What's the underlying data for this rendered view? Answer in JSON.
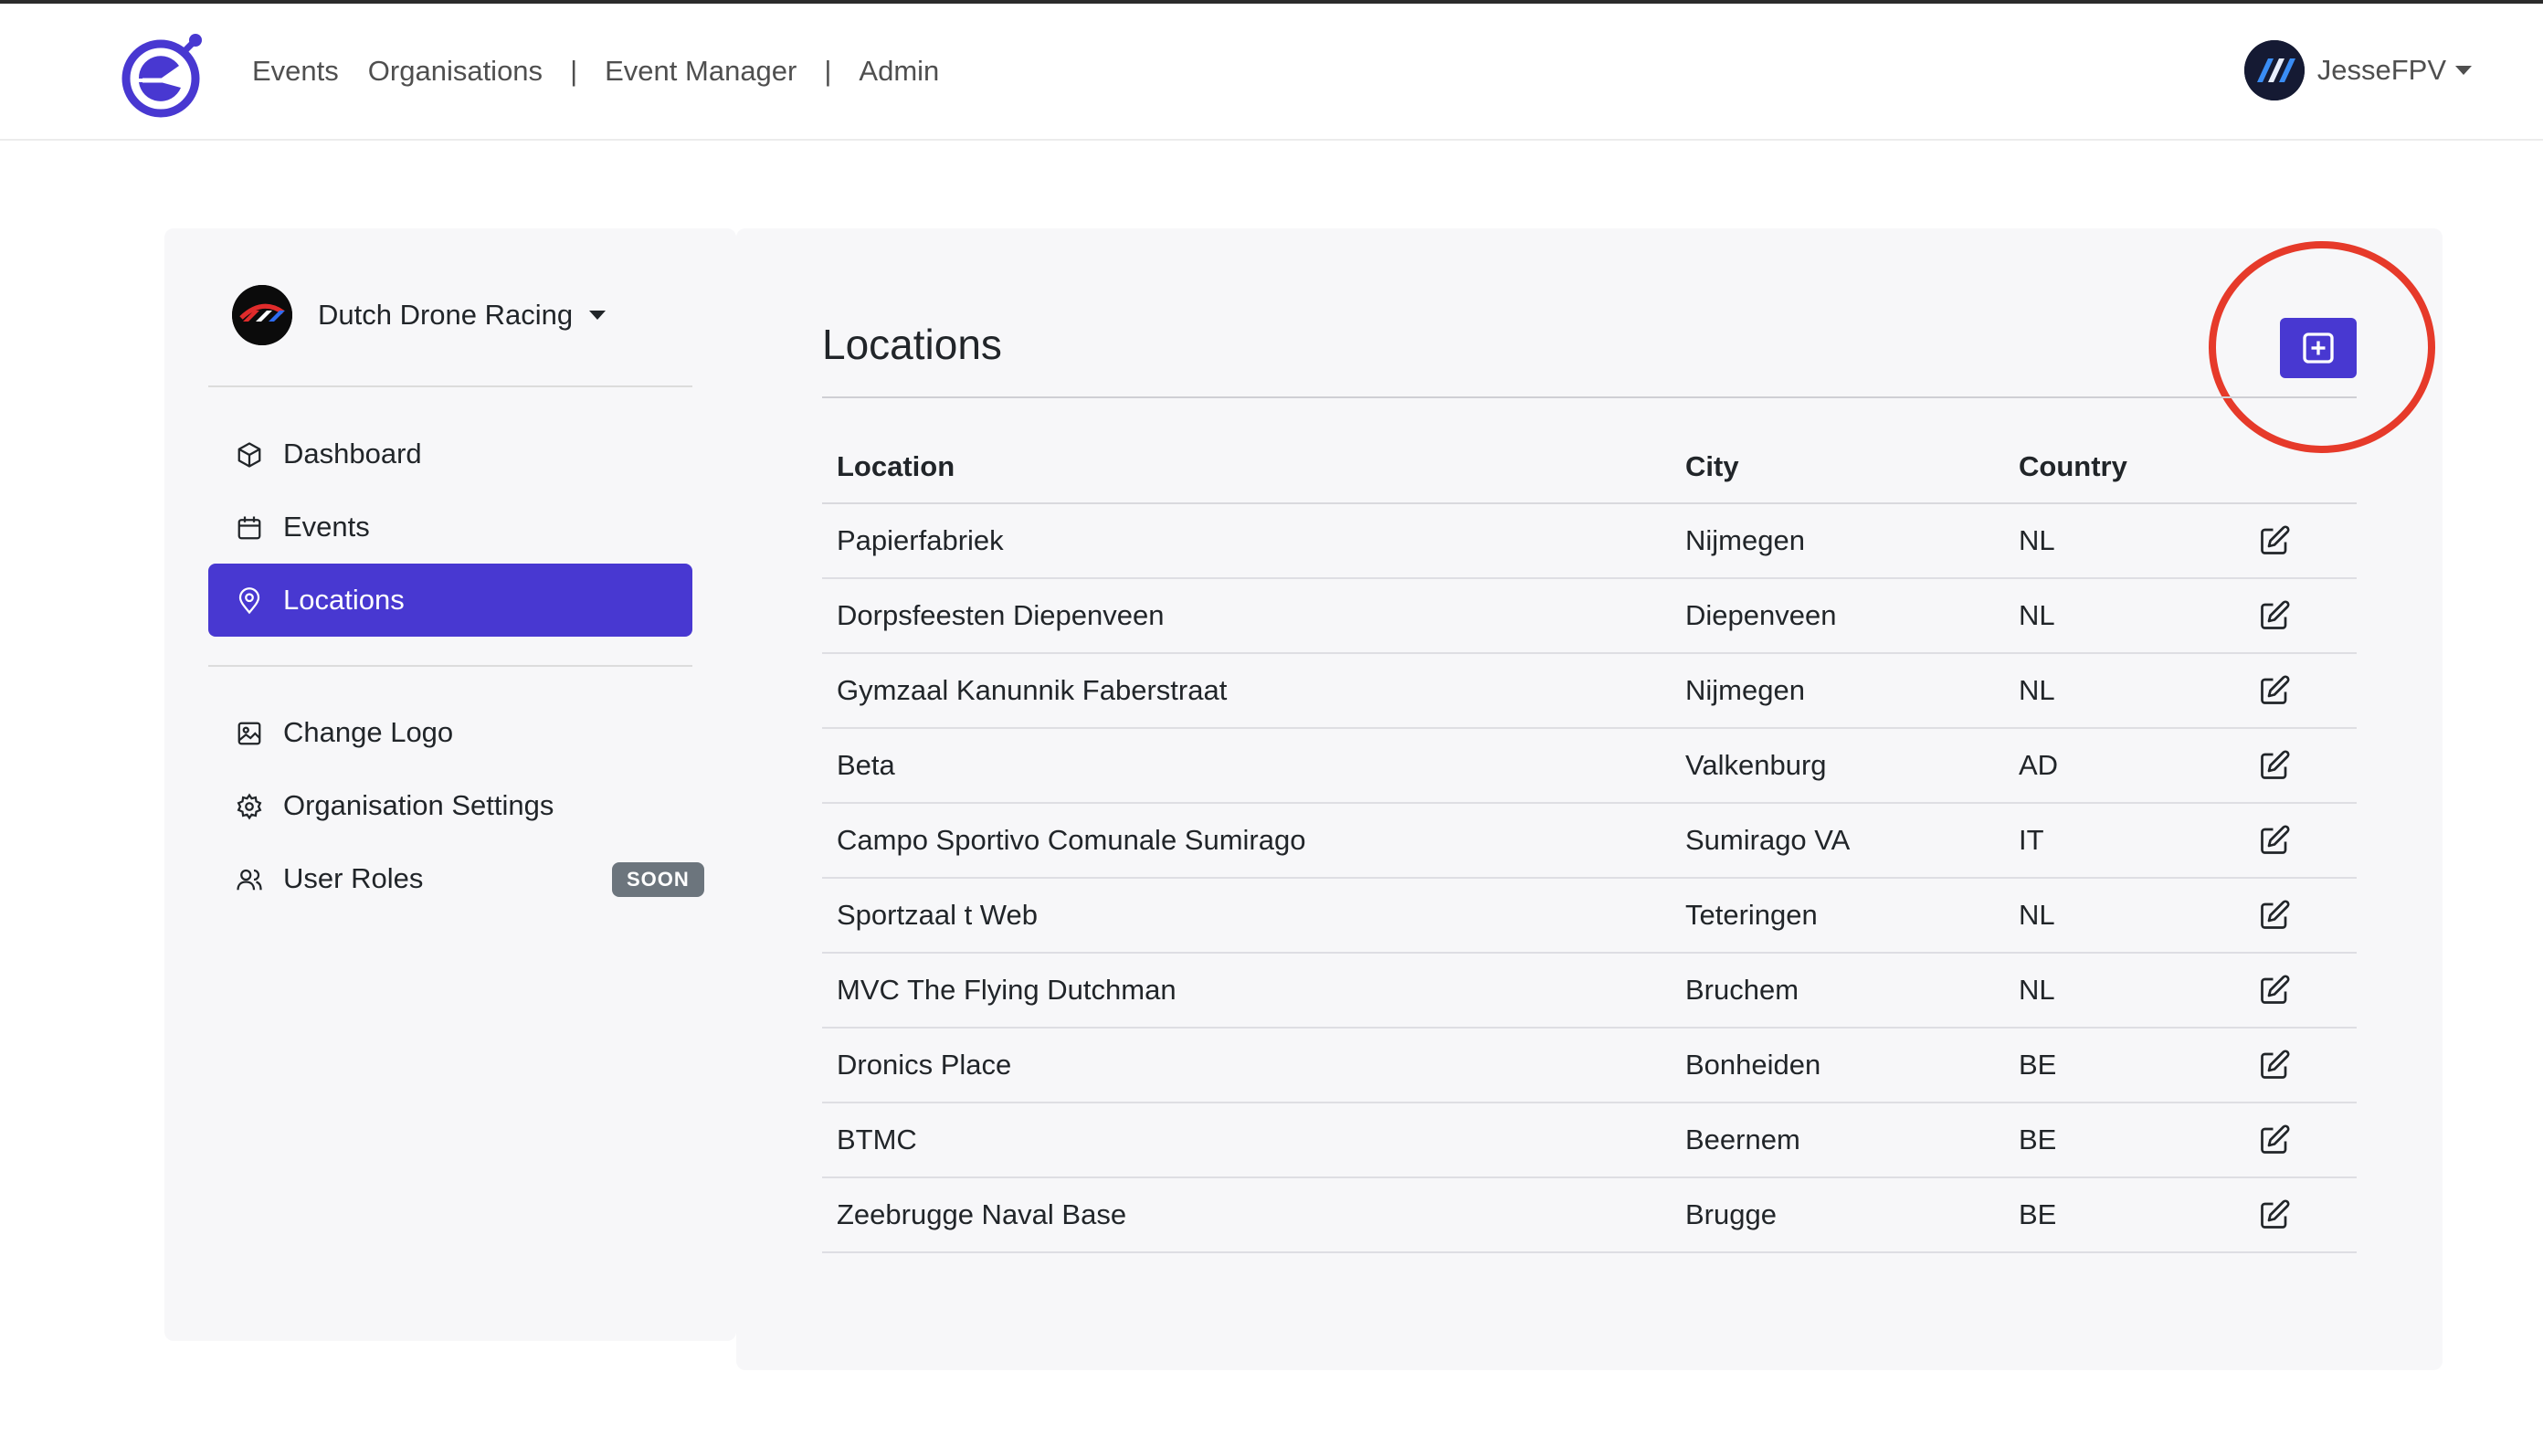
{
  "nav": {
    "links": [
      "Events",
      "Organisations",
      "Event Manager",
      "Admin"
    ],
    "separator": "|",
    "user_name": "JesseFPV"
  },
  "sidebar": {
    "org_name": "Dutch Drone Racing",
    "items": [
      {
        "label": "Dashboard",
        "icon": "box-icon"
      },
      {
        "label": "Events",
        "icon": "calendar-icon"
      },
      {
        "label": "Locations",
        "icon": "map-pin-icon",
        "active": true
      },
      {
        "label": "Change Logo",
        "icon": "image-icon"
      },
      {
        "label": "Organisation Settings",
        "icon": "gear-icon"
      },
      {
        "label": "User Roles",
        "icon": "users-icon",
        "badge": "SOON"
      }
    ]
  },
  "main": {
    "title": "Locations",
    "add_button_icon": "plus-square-icon",
    "table": {
      "headers": [
        "Location",
        "City",
        "Country"
      ],
      "rows": [
        {
          "location": "Papierfabriek",
          "city": "Nijmegen",
          "country": "NL"
        },
        {
          "location": "Dorpsfeesten Diepenveen",
          "city": "Diepenveen",
          "country": "NL"
        },
        {
          "location": "Gymzaal Kanunnik Faberstraat",
          "city": "Nijmegen",
          "country": "NL"
        },
        {
          "location": "Beta",
          "city": "Valkenburg",
          "country": "AD"
        },
        {
          "location": "Campo Sportivo Comunale Sumirago",
          "city": "Sumirago VA",
          "country": "IT"
        },
        {
          "location": "Sportzaal t Web",
          "city": "Teteringen",
          "country": "NL"
        },
        {
          "location": "MVC The Flying Dutchman",
          "city": "Bruchem",
          "country": "NL"
        },
        {
          "location": "Dronics Place",
          "city": "Bonheiden",
          "country": "BE"
        },
        {
          "location": "BTMC",
          "city": "Beernem",
          "country": "BE"
        },
        {
          "location": "Zeebrugge Naval Base",
          "city": "Brugge",
          "country": "BE"
        }
      ]
    }
  },
  "colors": {
    "accent": "#4838d1",
    "highlight": "#e63a2a",
    "panel": "#f7f7f9"
  }
}
